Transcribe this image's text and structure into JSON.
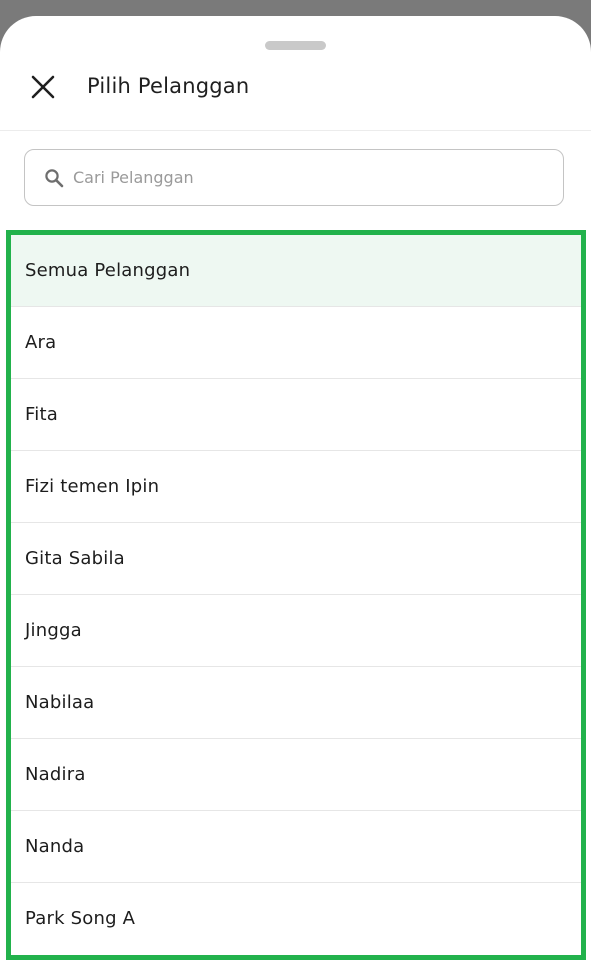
{
  "header": {
    "title": "Pilih Pelanggan"
  },
  "search": {
    "placeholder": "Cari Pelanggan",
    "value": ""
  },
  "list": {
    "items": [
      {
        "label": "Semua Pelanggan",
        "selected": true
      },
      {
        "label": "Ara",
        "selected": false
      },
      {
        "label": "Fita",
        "selected": false
      },
      {
        "label": "Fizi temen Ipin",
        "selected": false
      },
      {
        "label": "Gita Sabila",
        "selected": false
      },
      {
        "label": "Jingga",
        "selected": false
      },
      {
        "label": "Nabilaa",
        "selected": false
      },
      {
        "label": "Nadira",
        "selected": false
      },
      {
        "label": "Nanda",
        "selected": false
      },
      {
        "label": "Park Song A",
        "selected": false
      }
    ]
  },
  "icons": {
    "close": "close-icon",
    "search": "search-icon"
  },
  "colors": {
    "highlight_border": "#22b24c",
    "selected_row_bg": "#eef8f2",
    "backdrop": "#7a7a7a"
  }
}
